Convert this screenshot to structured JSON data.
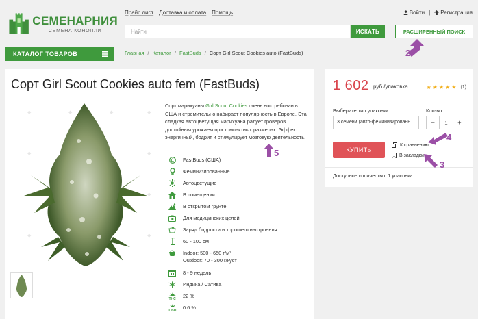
{
  "header": {
    "logo_title": "СЕМЕНАРНИЯ",
    "logo_sub": "СЕМЕНА КОНОПЛИ",
    "nav": [
      "Прайс лист",
      "Доставка и оплата",
      "Помощь"
    ],
    "login": "Войти",
    "register": "Регистрация",
    "search_placeholder": "Найти",
    "search_button": "ИСКАТЬ",
    "advanced_search": "РАСШИРЕННЫЙ ПОИСК"
  },
  "catalog_button": "КАТАЛОГ ТОВАРОВ",
  "breadcrumbs": [
    "Главная",
    "Каталог",
    "FastBuds",
    "Сорт Girl Scout Cookies auto (FastBuds)"
  ],
  "product": {
    "title": "Сорт Girl Scout Cookies auto fem (FastBuds)",
    "desc_before": "Сорт марихуаны ",
    "desc_link": "Girl Scout Cookies",
    "desc_after": " очень востребован в США и стремительно набирает популярность в Европе. Эта сладкая автоцветущая марихуана радует гроверов достойным урожаем при компактных размерах. Эффект энергичный, бодрит и стимулирует мозговую деятельность.",
    "features": [
      {
        "icon": "copyright-icon",
        "text": "FastBuds (США)"
      },
      {
        "icon": "female-icon",
        "text": "Феминизированные"
      },
      {
        "icon": "sun-icon",
        "text": "Автоцветущие"
      },
      {
        "icon": "house-icon",
        "text": "В помещении"
      },
      {
        "icon": "field-icon",
        "text": "В открытом грунте"
      },
      {
        "icon": "medical-kit-icon",
        "text": "Для медицинских целей"
      },
      {
        "icon": "mood-icon",
        "text": "Заряд бодрости и хорошего настроения"
      },
      {
        "icon": "height-icon",
        "text": "60 - 100 см"
      },
      {
        "icon": "harvest-icon",
        "text": "Indoor: 500 - 650 г/м²",
        "text2": "Outdoor: 70 - 300 г/куст"
      },
      {
        "icon": "calendar-icon",
        "text": "8 - 9 недель"
      },
      {
        "icon": "leaf-icon",
        "text": "Индика / Сатива"
      },
      {
        "icon": "thc-icon",
        "text": "22 %"
      },
      {
        "icon": "cbd-icon",
        "text": "0.6 %"
      }
    ]
  },
  "purchase": {
    "price": "1 602",
    "price_unit": "руб./упаковка",
    "rating_count": "(1)",
    "rating": 5,
    "pack_label": "Выберите тип упаковки:",
    "pack_value": "3 семени (авто-феминизированн...",
    "qty_label": "Кол-во:",
    "qty_minus": "−",
    "qty_value": "1",
    "qty_plus": "+",
    "buy": "КУПИТЬ",
    "compare": "К сравнению",
    "bookmark": "В закладки",
    "availability": "Доступное количество: 1 упаковка"
  },
  "annotations": [
    "2",
    "4",
    "3",
    "5"
  ],
  "colors": {
    "brand_green": "#3f9a3d",
    "price_red": "#d9434b",
    "buy_red": "#e05358",
    "annotation_purple": "#9b4fa6",
    "star_gold": "#f2b01e"
  }
}
